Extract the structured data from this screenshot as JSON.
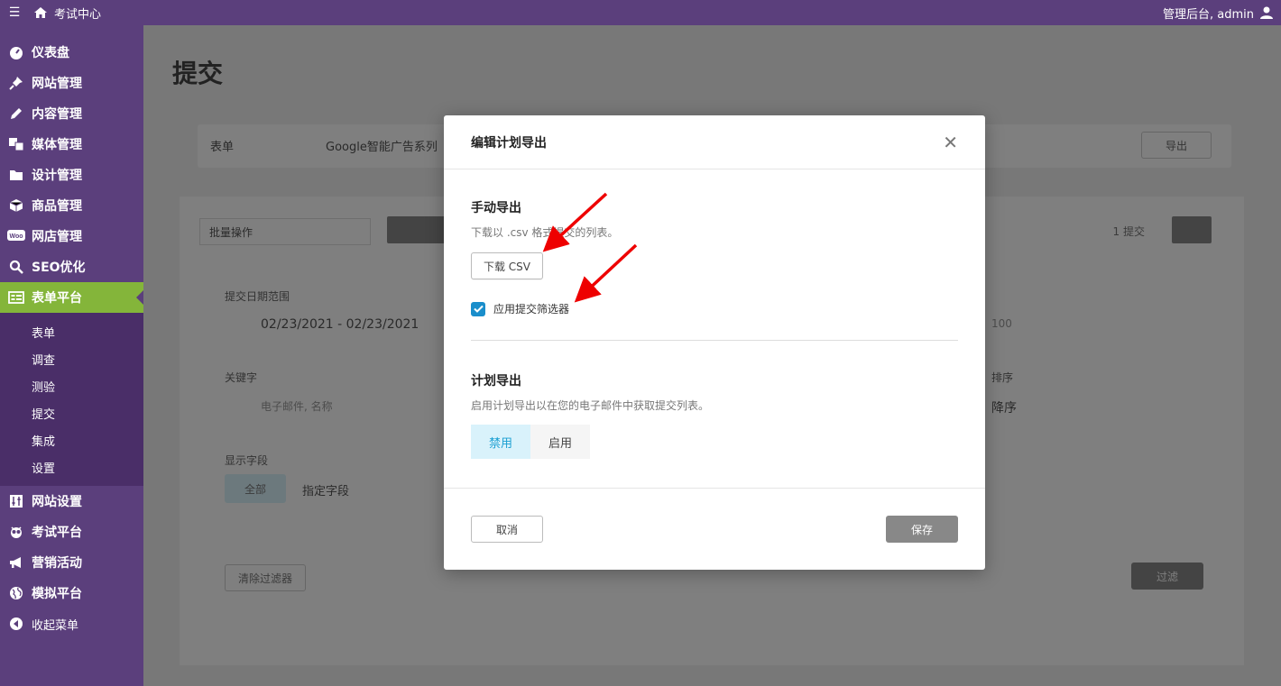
{
  "topbar": {
    "menu_icon": "menu-icon",
    "site_name": "考试中心",
    "user_text": "管理后台, admin"
  },
  "sidebar": {
    "items": [
      {
        "label": "仪表盘",
        "icon": "dashboard-icon"
      },
      {
        "label": "网站管理",
        "icon": "pin-icon"
      },
      {
        "label": "内容管理",
        "icon": "pencil-icon"
      },
      {
        "label": "媒体管理",
        "icon": "media-icon"
      },
      {
        "label": "设计管理",
        "icon": "folder-icon"
      },
      {
        "label": "商品管理",
        "icon": "box-icon"
      },
      {
        "label": "网店管理",
        "icon": "woo-icon"
      },
      {
        "label": "SEO优化",
        "icon": "search-icon"
      },
      {
        "label": "表单平台",
        "icon": "form-icon",
        "active": true
      }
    ],
    "submenu": [
      "表单",
      "调查",
      "测验",
      "提交",
      "集成",
      "设置"
    ],
    "items_after": [
      {
        "label": "网站设置",
        "icon": "settings-sliders-icon"
      },
      {
        "label": "考试平台",
        "icon": "owl-icon"
      },
      {
        "label": "营销活动",
        "icon": "megaphone-icon"
      },
      {
        "label": "模拟平台",
        "icon": "globe-icon"
      },
      {
        "label": "收起菜单",
        "icon": "collapse-icon"
      }
    ]
  },
  "background": {
    "page_title": "提交",
    "filter_form_type": "表单",
    "filter_form_name": "Google智能广告系列",
    "export_label": "导出",
    "bulk_action": "批量操作",
    "count_label": "1 提交",
    "date_label": "提交日期范围",
    "date_value": "02/23/2021 - 02/23/2021",
    "keyword_label": "关键字",
    "keyword_placeholder": "电子邮件, 名称",
    "fields_label": "显示字段",
    "fields_all": "全部",
    "fields_specific": "指定字段",
    "order_label": "排序",
    "order_value": "降序",
    "per_page": "100",
    "clear_filter": "清除过滤器",
    "apply_filter": "过滤"
  },
  "modal": {
    "title": "编辑计划导出",
    "manual_title": "手动导出",
    "manual_desc": "下载以 .csv 格式提交的列表。",
    "download_csv": "下载 CSV",
    "apply_filter_label": "应用提交筛选器",
    "apply_filter_checked": true,
    "scheduled_title": "计划导出",
    "scheduled_desc": "启用计划导出以在您的电子邮件中获取提交列表。",
    "toggle_disable": "禁用",
    "toggle_enable": "启用",
    "toggle_selected": "禁用",
    "cancel": "取消",
    "save": "保存"
  },
  "colors": {
    "sidebar_bg": "#5b3f7c",
    "active_item": "#84b53a",
    "checkbox": "#1a8ecb",
    "toggle_on_bg": "#d9f2fb",
    "toggle_on_text": "#1a9fd2",
    "arrow": "#ee0000"
  }
}
